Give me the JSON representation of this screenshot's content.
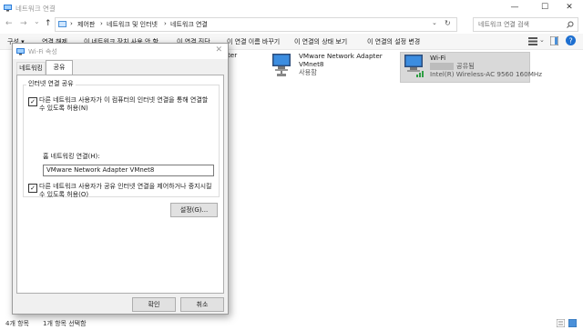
{
  "window": {
    "title": "네트워크 연결",
    "minimize_glyph": "—",
    "maximize_glyph": "☐",
    "close_glyph": "✕"
  },
  "nav": {
    "back_glyph": "←",
    "forward_glyph": "→",
    "dropdown_glyph": "⌄",
    "up_glyph": "↑",
    "breadcrumb": [
      "제어판",
      "네트워크 및 인터넷",
      "네트워크 연결"
    ],
    "separator": "›",
    "refresh_glyph": "↻",
    "search_placeholder": "네트워크 연결 검색"
  },
  "commands": {
    "organize": "구성 ▾",
    "disable": "연결 해제",
    "diagnose": "이 연결 진단",
    "diagnose_partial": "이 연결 진단",
    "rename": "이 연결 이름 바꾸기",
    "status": "이 연결의 상태 보기",
    "change_settings": "이 연결의 설정 변경",
    "bridge_partial": "이 네트워크 장치 사용 안 함"
  },
  "adapters": [
    {
      "name": "apter",
      "line2": "",
      "line3": ""
    },
    {
      "name": "VMware Network Adapter",
      "line2": "VMnet8",
      "line3": "사용함"
    },
    {
      "name": "Wi-Fi",
      "line2": "공유됨",
      "line3": "Intel(R) Wireless-AC 9560 160MHz"
    }
  ],
  "status": {
    "count": "4개 항목",
    "selected": "1개 항목 선택함"
  },
  "dialog": {
    "title": "Wi-Fi 속성",
    "close_glyph": "✕",
    "tabs": [
      "네트워킹",
      "공유"
    ],
    "group_label": "인터넷 연결 공유",
    "check1_label": "다른 네트워크 사용자가 이 컴퓨터의 인터넷 연결을 통해 연결할 수 있도록 허용(N)",
    "home_label": "홈 네트워킹 연결(H):",
    "home_value": "VMware Network Adapter VMnet8",
    "check2_label": "다른 네트워크 사용자가 공유 인터넷 연결을 제어하거나 중지시킬 수 있도록 허용(O)",
    "check_glyph": "✓",
    "settings_button": "설정(G)...",
    "ok_button": "확인",
    "cancel_button": "취소"
  },
  "colors": {
    "accent": "#0078d7",
    "selected_bg": "#cce8ff",
    "wifi_selected": "#d9d9d9"
  }
}
